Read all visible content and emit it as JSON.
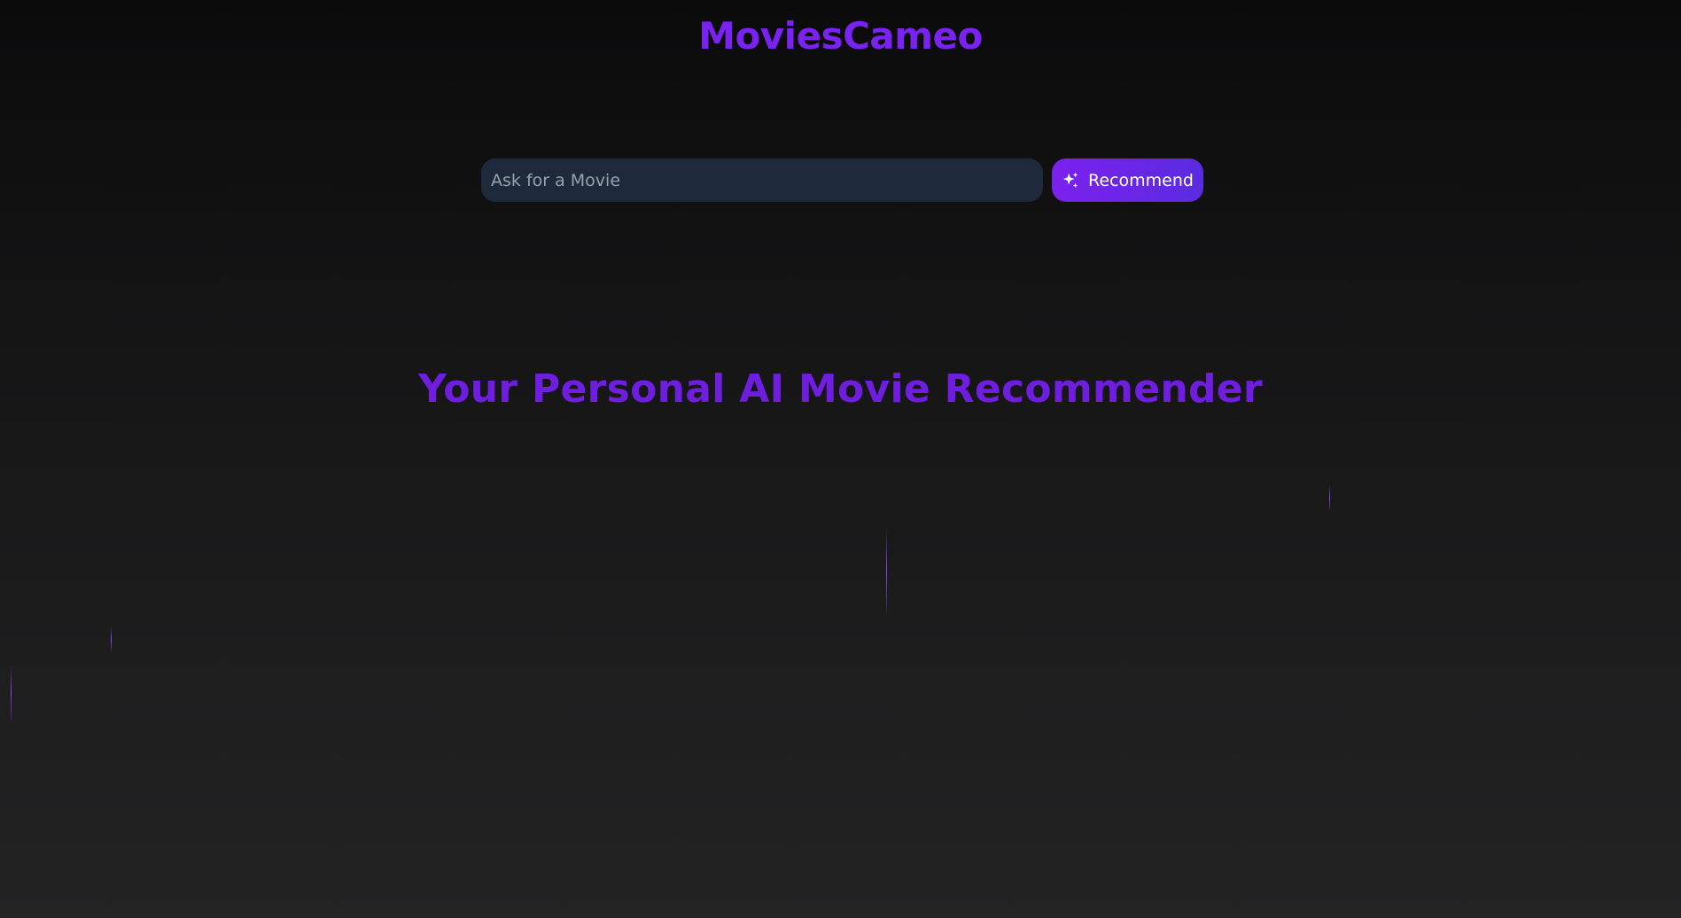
{
  "header": {
    "brand": "MoviesCameo"
  },
  "search": {
    "placeholder": "Ask for a Movie",
    "value": "",
    "button_label": "Recommend",
    "button_icon": "sparkles-icon"
  },
  "hero": {
    "title": "Your Personal AI Movie Recommender"
  },
  "colors": {
    "accent": "#7a22f0",
    "input_bg": "#1e293b",
    "button_start": "#7b21ee",
    "button_end": "#5a2be0"
  }
}
